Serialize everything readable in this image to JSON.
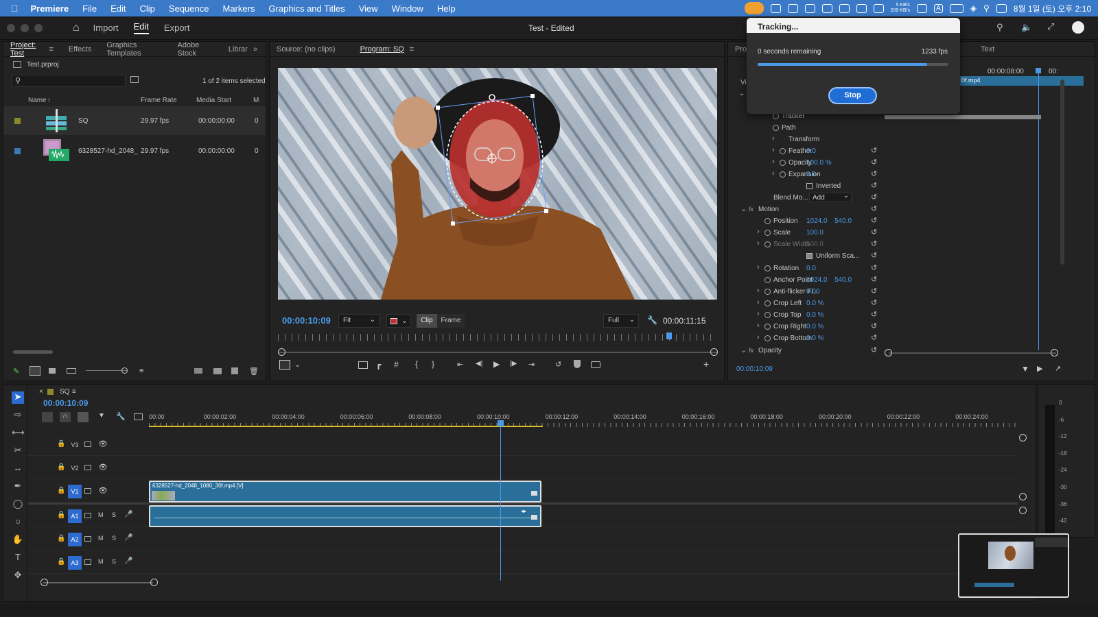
{
  "menubar": {
    "app_name": "Premiere",
    "items": [
      "File",
      "Edit",
      "Clip",
      "Sequence",
      "Markers",
      "Graphics and Titles",
      "View",
      "Window",
      "Help"
    ],
    "net_up": "5 KB/s",
    "net_down": "209 KB/s",
    "input_source": "A",
    "datetime": "8월 1일 (토) 오후 2:10"
  },
  "appbar": {
    "tabs": [
      "Import",
      "Edit",
      "Export"
    ],
    "active_tab": "Edit",
    "title": "Test - Edited"
  },
  "project_panel": {
    "tabs": [
      "Project: Test",
      "Effects",
      "Graphics Templates",
      "Adobe Stock",
      "Librar"
    ],
    "project_file": "Test.prproj",
    "selection_status": "1 of 2 items selected",
    "columns": [
      "Name",
      "Frame Rate",
      "Media Start",
      "M"
    ],
    "items": [
      {
        "name": "SQ",
        "frame_rate": "29.97 fps",
        "media_start": "00:00:00:00",
        "m": "0",
        "color": "#8a8a2a"
      },
      {
        "name": "6328527-hd_2048_",
        "frame_rate": "29.97 fps",
        "media_start": "00:00:00:00",
        "m": "0",
        "color": "#3a7ab8"
      }
    ]
  },
  "monitor": {
    "tabs": [
      "Source: (no clips)",
      "Program: SQ"
    ],
    "timecode": "00:00:10:09",
    "fit": "Fit",
    "clip_btn": "Clip",
    "frame_btn": "Frame",
    "quality": "Full",
    "duration": "00:00:11:15"
  },
  "effect_controls": {
    "tab_short": "Prop",
    "text_tab": "Text",
    "clip_timecode": "00:00:08:00",
    "clip_timecode_next": "00:",
    "clip_name": "0f.mp4",
    "vi_label": "Vi",
    "current_timecode": "00:00:10:09",
    "rows": [
      {
        "label": "Tracker",
        "value": ""
      },
      {
        "label": "Path",
        "value": ""
      },
      {
        "label": "Transform",
        "value": ""
      },
      {
        "label": "Feather",
        "value": "0.0"
      },
      {
        "label": "Opacity",
        "value": "100.0 %"
      },
      {
        "label": "Expansion",
        "value": "0.0"
      },
      {
        "label": "Inverted",
        "value": ""
      },
      {
        "label": "Blend Mo...",
        "value": "Add"
      },
      {
        "label": "Motion",
        "value": ""
      },
      {
        "label": "Position",
        "value": "1024.0",
        "value2": "540.0"
      },
      {
        "label": "Scale",
        "value": "100.0"
      },
      {
        "label": "Scale Width",
        "value": "100.0"
      },
      {
        "label": "Uniform Sca...",
        "value": ""
      },
      {
        "label": "Rotation",
        "value": "0.0"
      },
      {
        "label": "Anchor Point",
        "value": "1024.0",
        "value2": "540.0"
      },
      {
        "label": "Anti-flicker Fi...",
        "value": "0.00"
      },
      {
        "label": "Crop Left",
        "value": "0.0 %"
      },
      {
        "label": "Crop Top",
        "value": "0.0 %"
      },
      {
        "label": "Crop Right",
        "value": "0.0 %"
      },
      {
        "label": "Crop Bottom",
        "value": "0.0 %"
      },
      {
        "label": "Opacity",
        "value": ""
      }
    ]
  },
  "tracking_dialog": {
    "title": "Tracking...",
    "remaining": "0 seconds remaining",
    "fps": "1233 fps",
    "progress": 0.89,
    "stop_label": "Stop"
  },
  "timeline": {
    "sequence_name": "SQ",
    "timecode": "00:00:10:09",
    "ruler": [
      "00:00",
      "00:00:02:00",
      "00:00:04:00",
      "00:00:06:00",
      "00:00:08:00",
      "00:00:10:00",
      "00:00:12:00",
      "00:00:14:00",
      "00:00:16:00",
      "00:00:18:00",
      "00:00:20:00",
      "00:00:22:00",
      "00:00:24:00"
    ],
    "video_tracks": [
      "V3",
      "V2",
      "V1"
    ],
    "audio_tracks": [
      "A1",
      "A2",
      "A3"
    ],
    "video_clip": "6328527-hd_2048_1080_30f.mp4 [V]",
    "meter_labels": [
      "0",
      "-6",
      "-12",
      "-18",
      "-24",
      "-30",
      "-36",
      "-42"
    ]
  }
}
